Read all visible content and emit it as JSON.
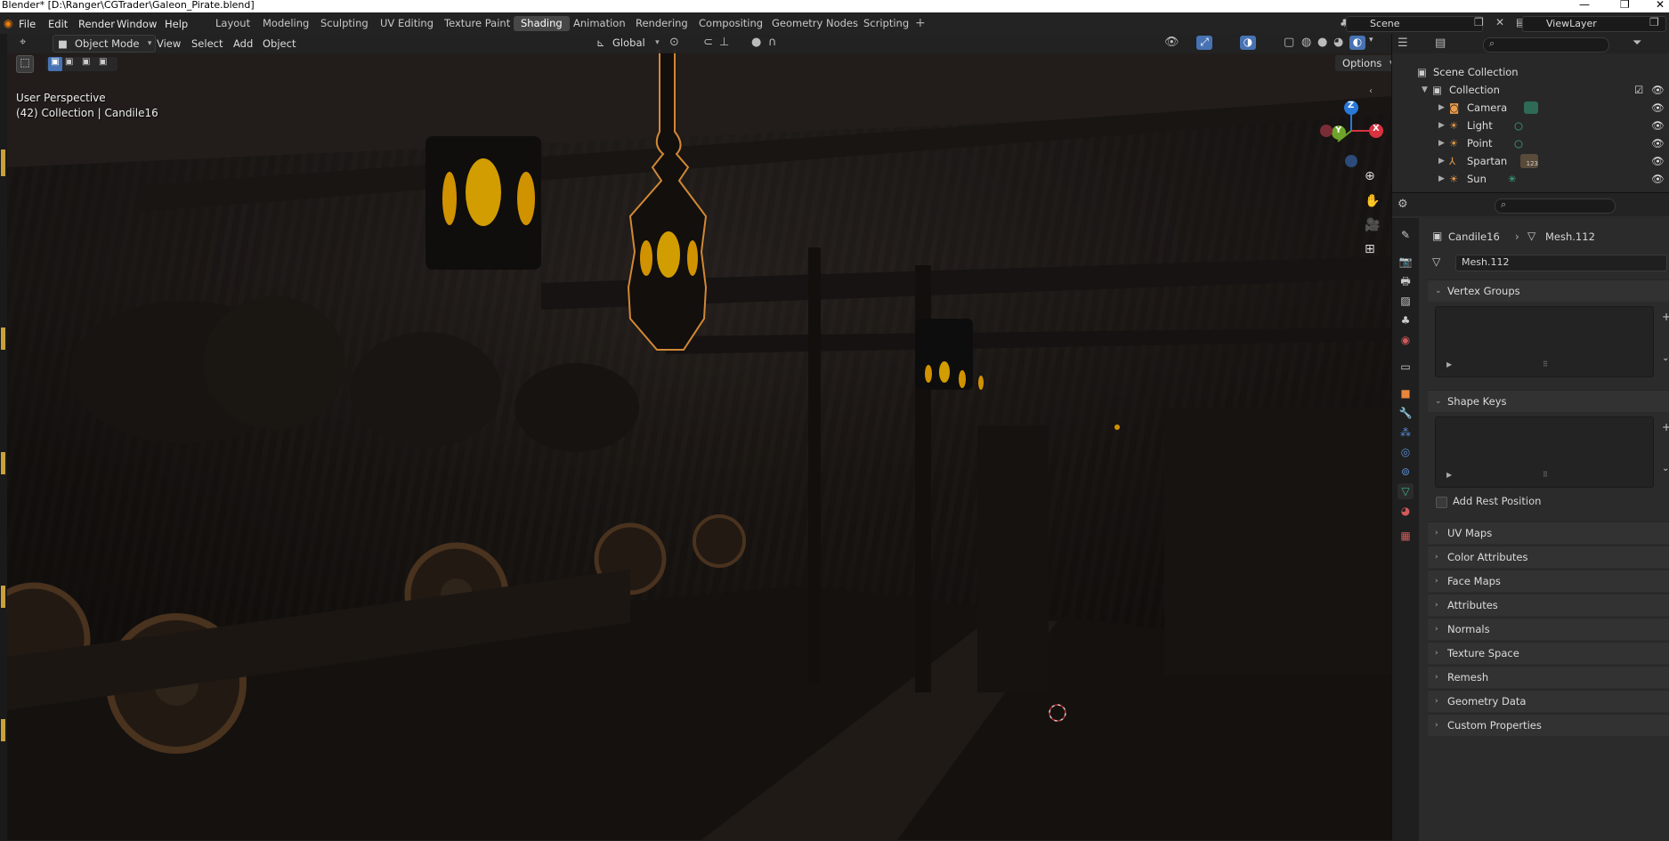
{
  "window": {
    "title": "Blender* [D:\\Ranger\\CGTrader\\Galeon_Pirate.blend]"
  },
  "menus": [
    "File",
    "Edit",
    "Render",
    "Window",
    "Help"
  ],
  "workspaces": [
    "Layout",
    "Modeling",
    "Sculpting",
    "UV Editing",
    "Texture Paint",
    "Shading",
    "Animation",
    "Rendering",
    "Compositing",
    "Geometry Nodes",
    "Scripting"
  ],
  "active_workspace": "Shading",
  "scene": {
    "name": "Scene"
  },
  "view_layer": {
    "name": "ViewLayer"
  },
  "viewport_header": {
    "mode": "Object Mode",
    "menus": [
      "View",
      "Select",
      "Add",
      "Object"
    ],
    "orientation": "Global",
    "options_label": "Options"
  },
  "viewport": {
    "perspective_label": "User Perspective",
    "collection_label": "(42) Collection | Candile16",
    "gizmo": {
      "x": "X",
      "y": "Y",
      "z": "Z"
    }
  },
  "outliner": {
    "scene_collection": "Scene Collection",
    "collection": "Collection",
    "items": [
      {
        "name": "Camera",
        "icon": "camera-icon"
      },
      {
        "name": "Light",
        "icon": "light-icon"
      },
      {
        "name": "Point",
        "icon": "light-icon"
      },
      {
        "name": "Spartan",
        "icon": "armature-icon",
        "badge": "123"
      },
      {
        "name": "Sun",
        "icon": "light-icon"
      }
    ]
  },
  "properties": {
    "breadcrumb_object": "Candile16",
    "breadcrumb_mesh": "Mesh.112",
    "mesh_name": "Mesh.112",
    "panels_open": [
      "Vertex Groups",
      "Shape Keys"
    ],
    "add_rest_position": "Add Rest Position",
    "panels_closed": [
      "UV Maps",
      "Color Attributes",
      "Face Maps",
      "Attributes",
      "Normals",
      "Texture Space",
      "Remesh",
      "Geometry Data",
      "Custom Properties"
    ]
  },
  "colors": {
    "accent": "#4772b3",
    "selection": "#ffa640",
    "lantern_glow": "#ffb300",
    "header_bg": "#232323"
  }
}
